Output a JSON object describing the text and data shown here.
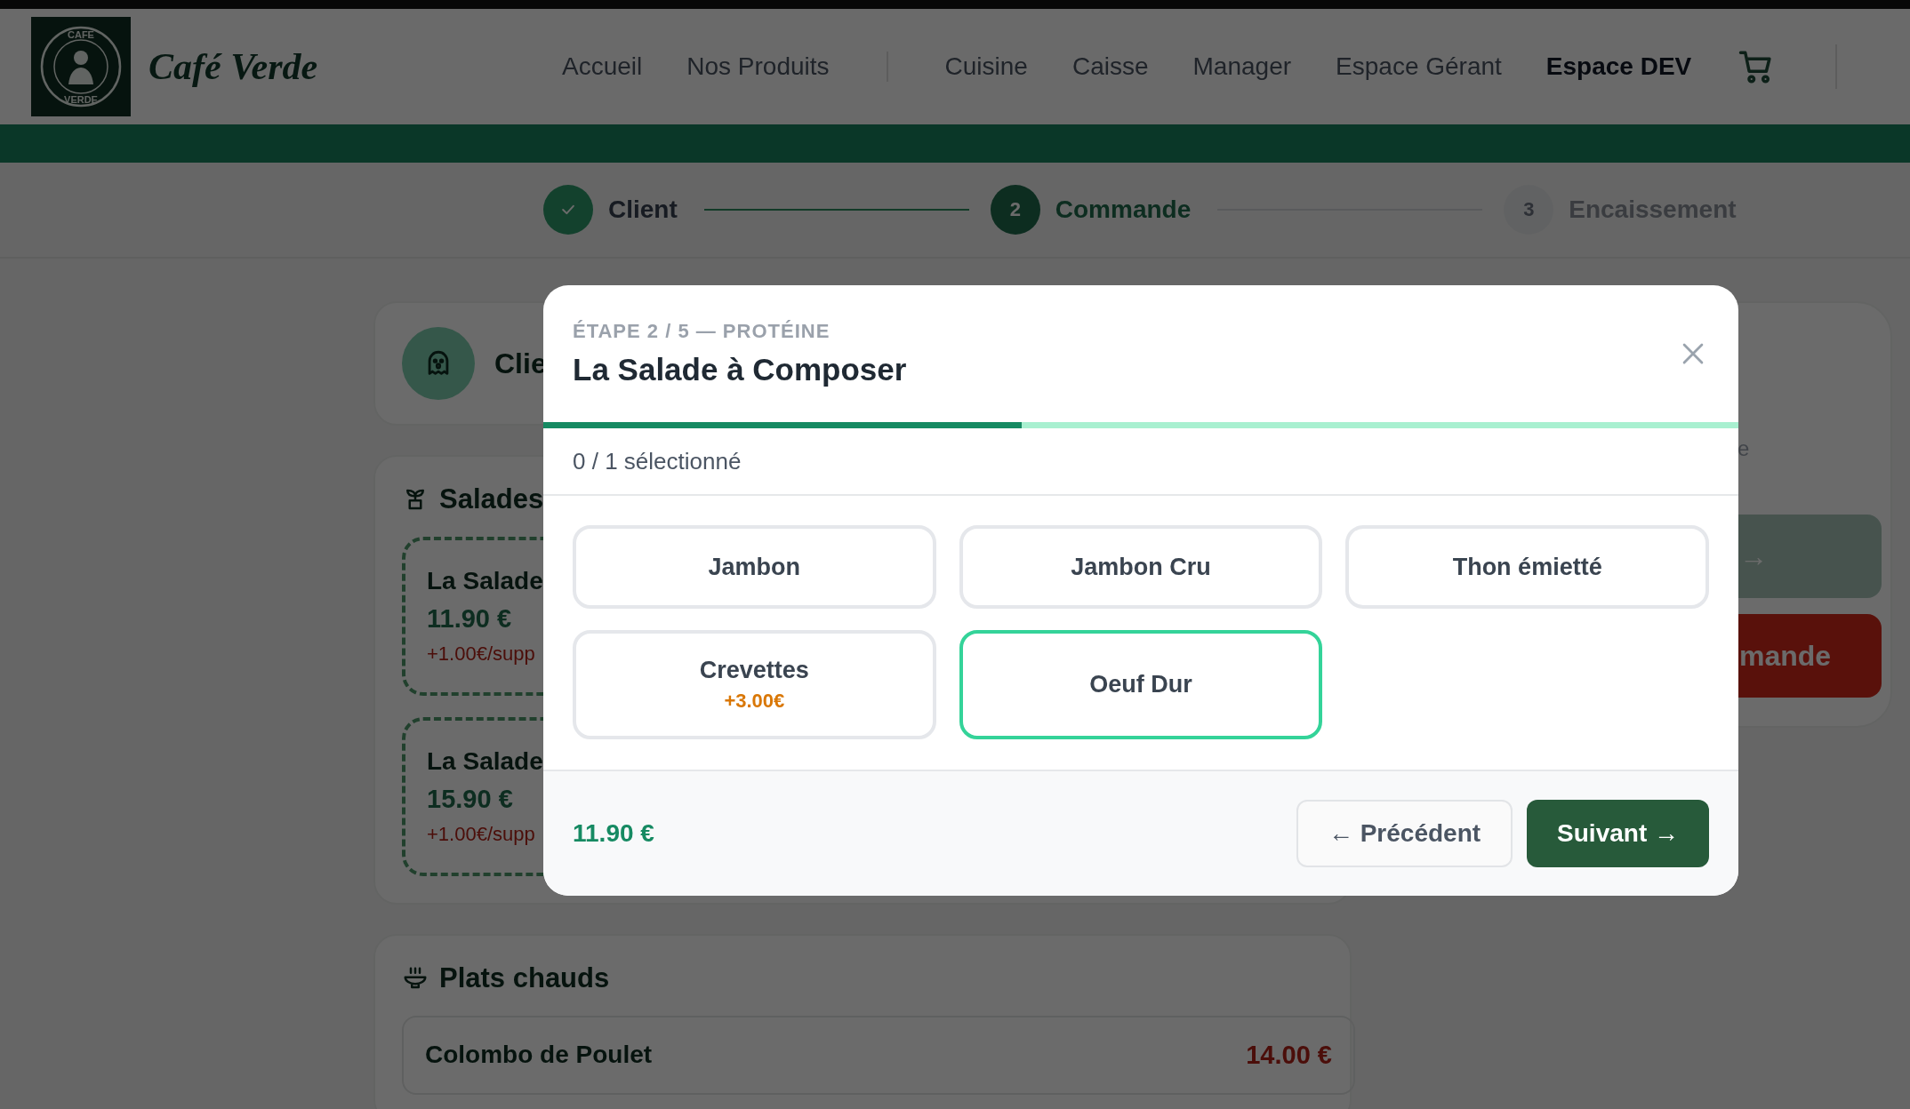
{
  "header": {
    "logo_text": [
      "CAFE",
      "VERDE"
    ],
    "brand": "Café Verde",
    "nav_main": [
      {
        "label": "Accueil",
        "selected": false
      },
      {
        "label": "Nos Produits",
        "selected": false
      }
    ],
    "nav_staff": [
      {
        "label": "Cuisine",
        "selected": false
      },
      {
        "label": "Caisse",
        "selected": false
      },
      {
        "label": "Manager",
        "selected": false
      },
      {
        "label": "Espace Gérant",
        "selected": false
      },
      {
        "label": "Espace DEV",
        "selected": true
      }
    ]
  },
  "stepper": [
    {
      "label": "Client",
      "completed": true,
      "selected": false
    },
    {
      "label": "Commande",
      "number": "2",
      "completed": false,
      "selected": true
    },
    {
      "label": "Encaissement",
      "number": "3",
      "completed": false,
      "selected": false
    }
  ],
  "client": {
    "label": "Clie"
  },
  "sections": [
    {
      "kind": "salads",
      "title": "Salades",
      "products": [
        {
          "name": "La Salade",
          "price": "11.90 €",
          "supplement": "+1.00€/supp"
        },
        {
          "name": "La Salade",
          "price": "15.90 €",
          "supplement": "+1.00€/supp"
        }
      ]
    },
    {
      "kind": "hot",
      "title": "Plats chauds",
      "products": [
        {
          "name": "Colombo de Poulet",
          "price": "14.00 €"
        }
      ]
    }
  ],
  "side_panel": {
    "note": "e",
    "buttons": [
      {
        "kind": "primary",
        "label": "→"
      },
      {
        "kind": "danger",
        "label": "mande"
      }
    ]
  },
  "modal": {
    "step_label": "ÉTAPE 2 / 5 — PROTÉINE",
    "title": "La Salade à Composer",
    "progress": {
      "level": 0.4
    },
    "count": "0 / 1 sélectionné",
    "options": [
      {
        "label": "Jambon",
        "selected": false
      },
      {
        "label": "Jambon Cru",
        "selected": false
      },
      {
        "label": "Thon émietté",
        "selected": false
      },
      {
        "label": "Crevettes",
        "extra": "+3.00€",
        "selected": false
      },
      {
        "label": "Oeuf Dur",
        "selected": true
      }
    ],
    "total": "11.90 €",
    "buttons": [
      {
        "kind": "back",
        "label": "← Précédent"
      },
      {
        "kind": "next",
        "label": "Suivant →"
      }
    ]
  }
}
